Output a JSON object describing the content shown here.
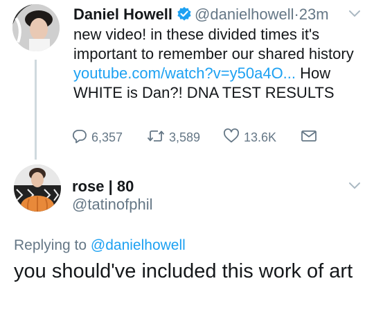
{
  "tweet": {
    "author_name": "Daniel Howell",
    "author_handle": "@danielhowell",
    "separator": "·",
    "time": "23m",
    "text_before_link": "new video! in these divided times it's important to remember our shared history ",
    "link_text": "youtube.com/watch?v=y50a4O...",
    "text_after_link": " How WHITE is Dan?! DNA TEST RESULTS",
    "reply_count": "6,357",
    "retweet_count": "3,589",
    "like_count": "13.6K"
  },
  "reply": {
    "author_name": "rose | 80",
    "author_handle": "@tatinofphil",
    "replying_to_prefix": "Replying to",
    "replying_to_handle": "@danielhowell",
    "text": "you should've included this work of art"
  },
  "colors": {
    "link": "#1da1f2",
    "secondary_text": "#657786",
    "thread_line": "#cfd9de"
  },
  "icons": [
    "verified-badge-icon",
    "chevron-down-icon",
    "reply-icon",
    "retweet-icon",
    "heart-icon",
    "message-icon"
  ]
}
